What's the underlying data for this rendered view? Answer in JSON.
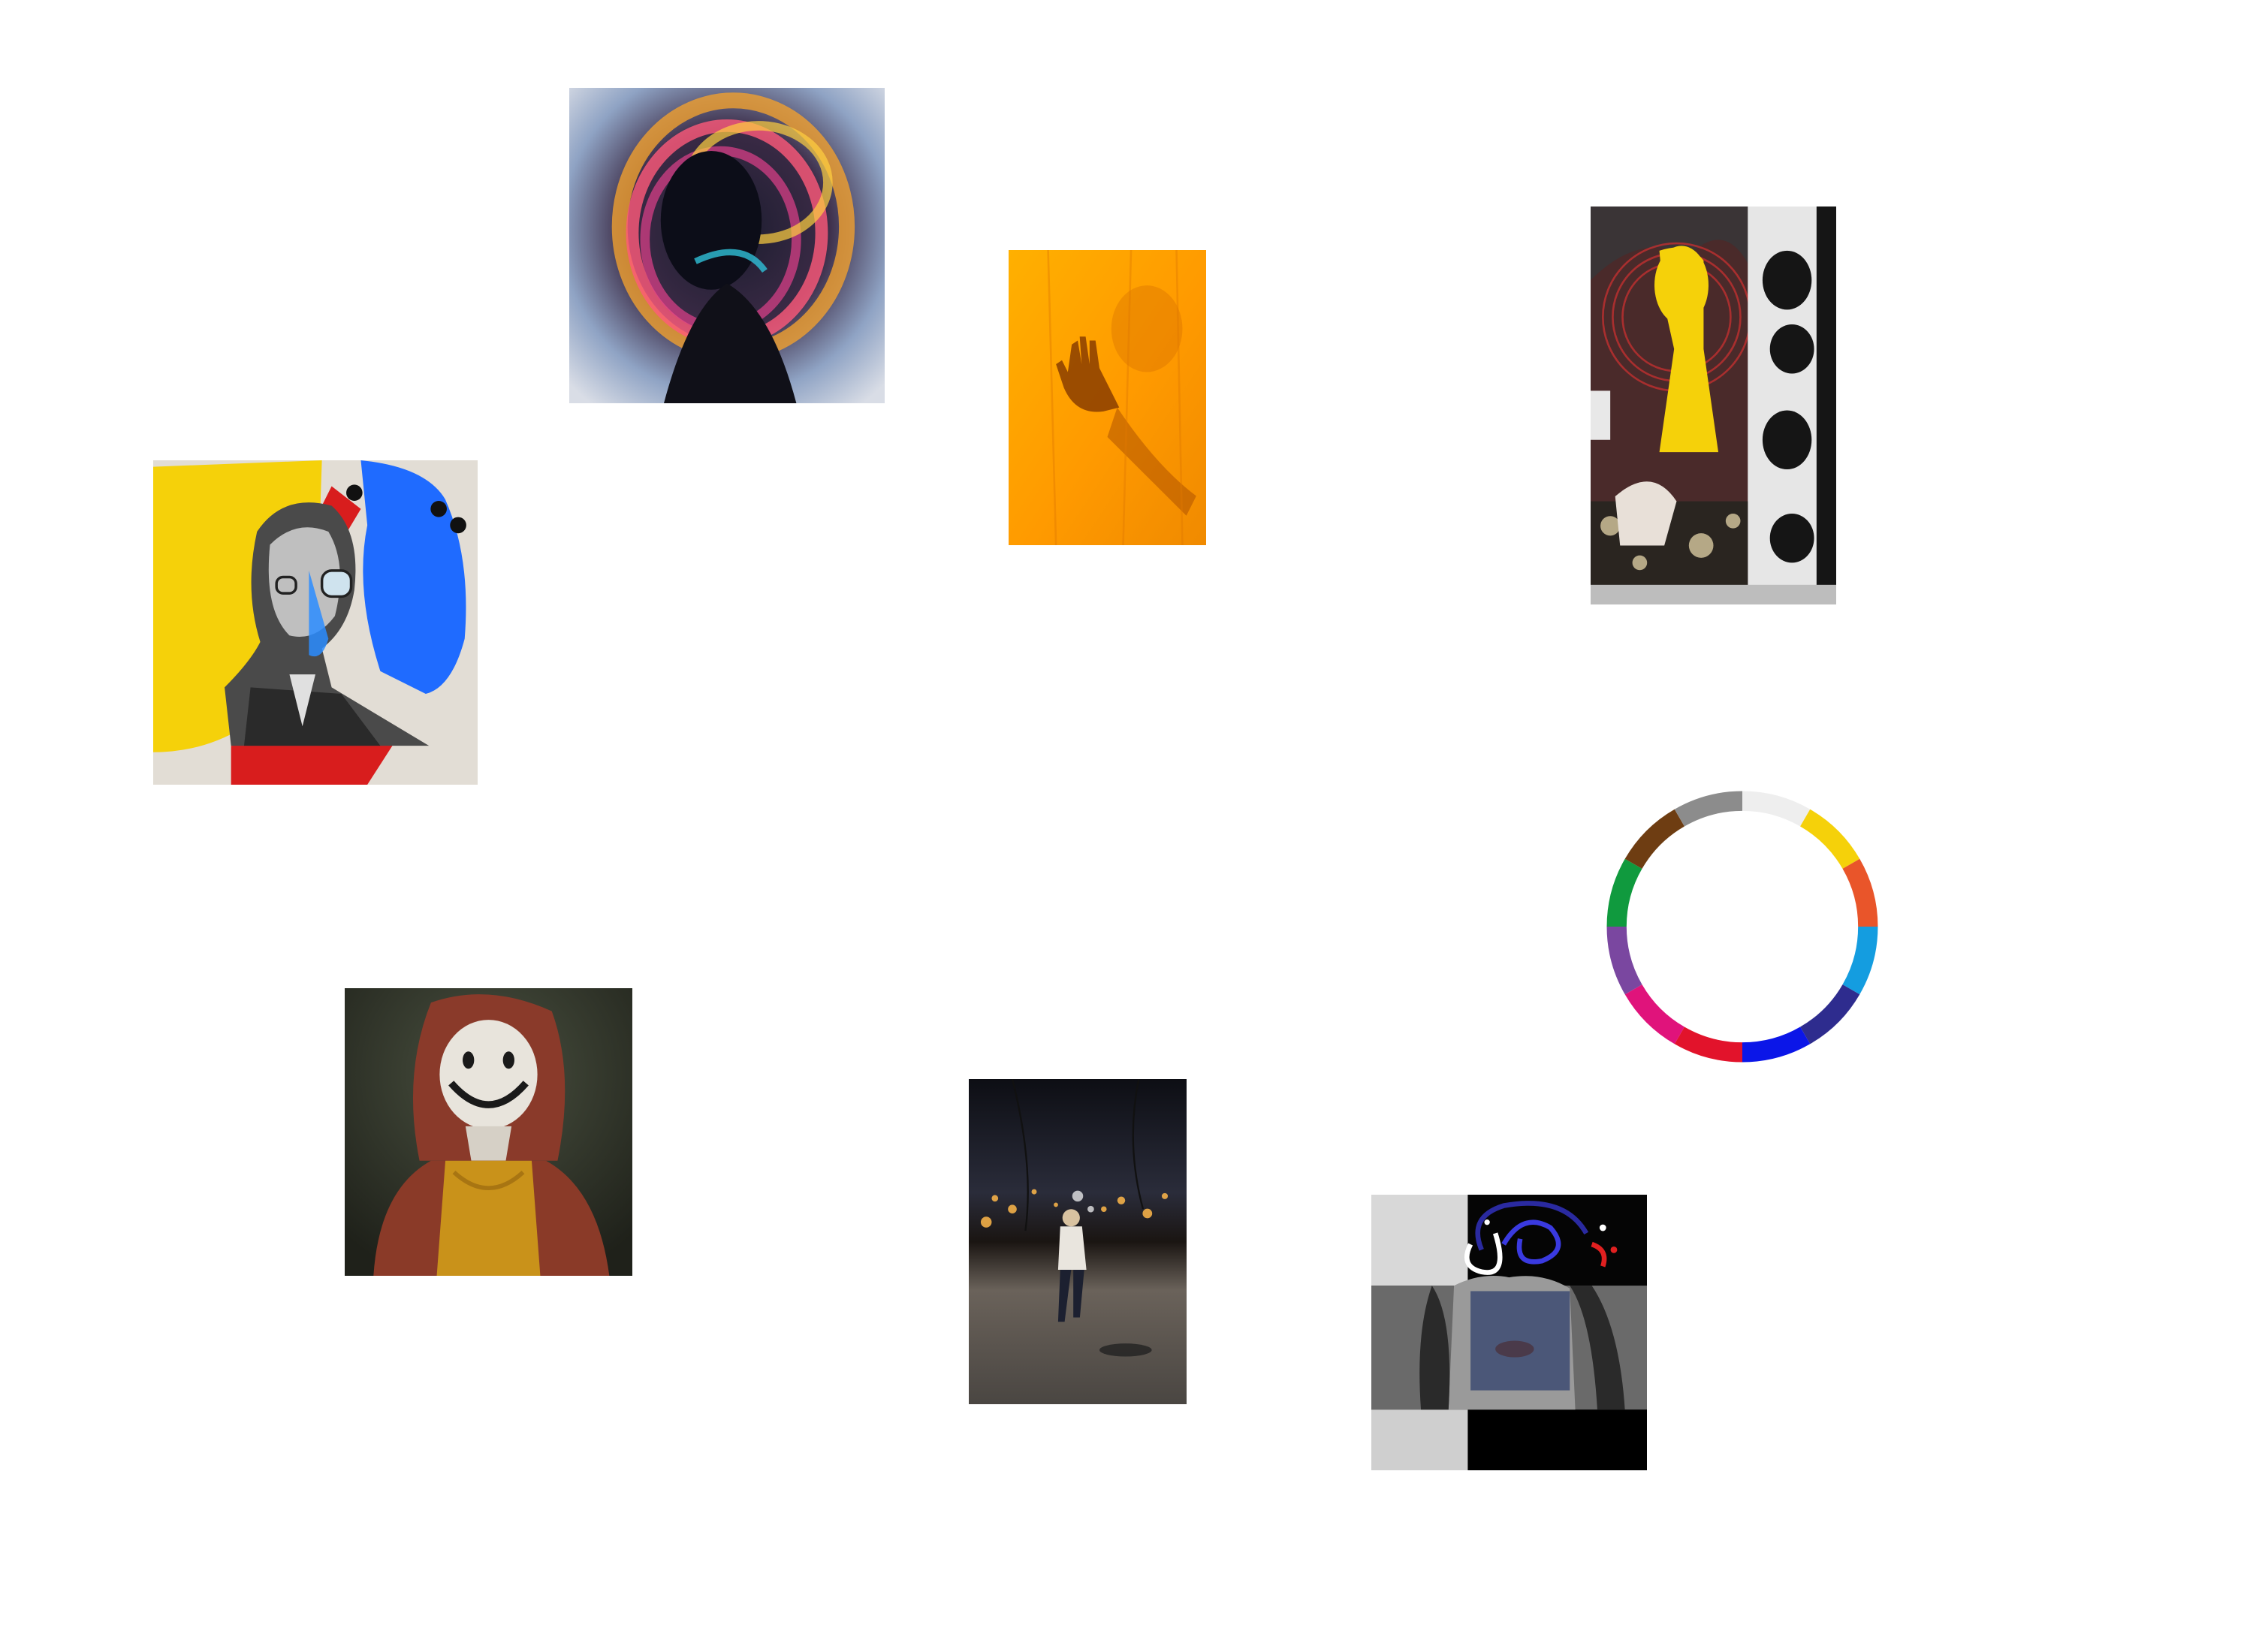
{
  "board": {
    "background": "#ffffff",
    "images": [
      {
        "icon": "abstract-neon-swirl-portrait-image"
      },
      {
        "icon": "hand-silhouette-orange-curtain-image"
      },
      {
        "icon": "collage-woman-yellow-mask-image"
      },
      {
        "icon": "collage-man-primary-colors-image"
      },
      {
        "icon": "smiley-mask-hooded-portrait-image"
      },
      {
        "icon": "child-walking-night-street-image"
      },
      {
        "icon": "collage-checkered-face-image"
      }
    ]
  },
  "color_wheel": {
    "icon": "color-wheel-ring",
    "segments": [
      "#eeeeee",
      "#f5d10a",
      "#e9552a",
      "#149de0",
      "#2e2c8e",
      "#0b16e8",
      "#e2132b",
      "#e0137b",
      "#7a47a0",
      "#109a3e",
      "#6e3d12",
      "#8c8c8c"
    ]
  }
}
